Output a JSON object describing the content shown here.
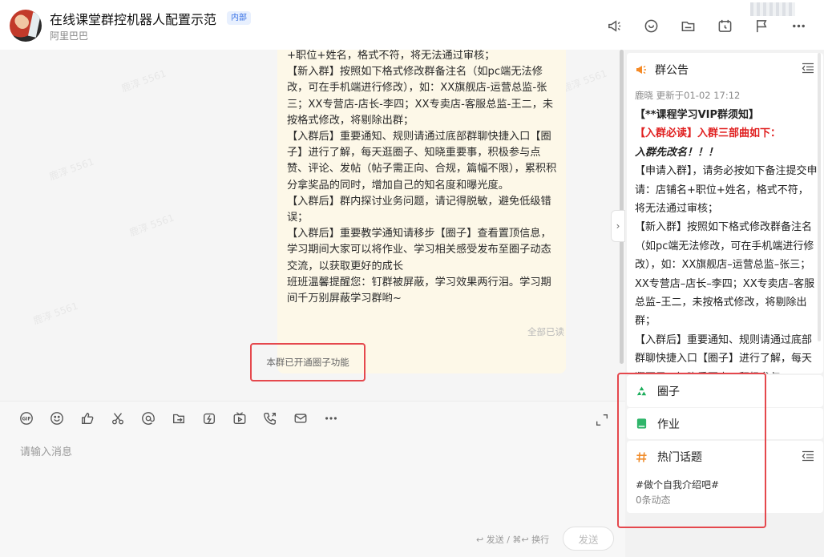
{
  "header": {
    "title": "在线课堂群控机器人配置示范",
    "badge": "内部",
    "subtitle": "阿里巴巴",
    "icons": [
      "announcement-icon",
      "chat-bubble-icon",
      "folder-icon",
      "calendar-icon",
      "flag-icon",
      "more-icon"
    ]
  },
  "chat": {
    "message_lines": [
      "+职位+姓名，格式不符，将无法通过审核；",
      "【新入群】按照如下格式修改群备注名（如pc端无法修改，可在手机端进行修改），如：XX旗舰店-运营总监-张三；XX专营店-店长-李四；XX专卖店-客服总监-王二，未按格式修改，将剔除出群；",
      "【入群后】重要通知、规则请通过底部群聊快捷入口【圈子】进行了解，每天逛圈子、知晓重要事，积极参与点赞、评论、发帖（帖子需正向、合规，篇幅不限），累积积分拿奖品的同时，增加自己的知名度和曝光度。",
      "【入群后】群内探讨业务问题，请记得脱敏，避免低级错误；",
      "【入群后】重要教学通知请移步【圈子】查看置顶信息，学习期间大家可以将作业、学习相关感受发布至圈子动态交流，以获取更好的成长",
      "班班温馨提醒您：钉群被屏蔽，学习效果两行泪。学习期间千万别屏蔽学习群哟~"
    ],
    "read_status": "全部已读",
    "system_note": "本群已开通圈子功能",
    "watermark": "鹿淳 5561"
  },
  "toolbar": {
    "icons": [
      "gif-icon",
      "emoji-icon",
      "thumbs-up-icon",
      "scissors-icon",
      "mention-icon",
      "forward-icon",
      "flash-icon",
      "video-icon",
      "phone-icon",
      "mail-icon",
      "more-icon"
    ],
    "placeholder": "请输入消息",
    "send_hint": "↩ 发送 / ⌘↩ 换行",
    "send_label": "发送"
  },
  "announcement": {
    "title": "群公告",
    "meta": "鹿晓  更新于01-02 17:12",
    "heading": "【**课程学习VIP群须知】",
    "red_line": "【入群必读】入群三部曲如下：",
    "italic_line": "入群先改名！！！",
    "body": "【申请入群】，请务必按如下备注提交申请：店铺名+职位+姓名，格式不符，将无法通过审核；\n【新入群】按照如下格式修改群备注名（如pc端无法修改，可在手机端进行修改），如：XX旗舰店–运营总监–张三；XX专营店–店长–李四；XX专卖店–客服总监–王二，未按格式修改，将剔除出群；\n【入群后】重要通知、规则请通过底部群聊快捷入口【圈子】进行了解，每天逛圈子，知晓重要事，积极参与"
  },
  "side": {
    "circle_label": "圈子",
    "homework_label": "作业",
    "topics_label": "热门话题",
    "topic_tag": "#做个自我介绍吧#",
    "topic_count": "0条动态"
  },
  "colors": {
    "accent_red": "#e5484d",
    "circle_green": "#1aad5a",
    "homework_green": "#2fb56a",
    "topic_orange": "#f08c2a",
    "announce_orange": "#f58a26"
  }
}
